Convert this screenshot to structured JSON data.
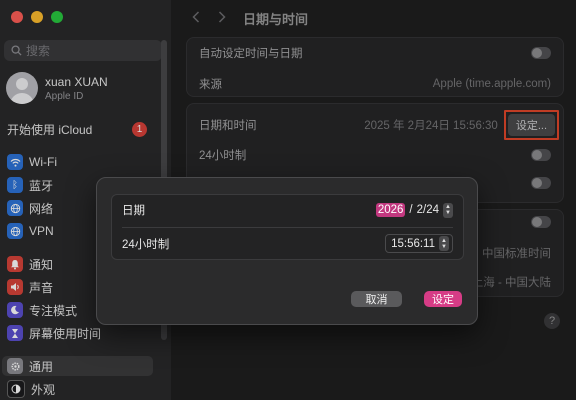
{
  "search": {
    "placeholder": "搜索"
  },
  "account": {
    "name": "xuan XUAN",
    "subtitle": "Apple ID"
  },
  "icloud": {
    "label": "开始使用 iCloud",
    "badge": "1"
  },
  "sidebar": {
    "items": [
      {
        "label": "Wi-Fi",
        "icon": "wifi-icon",
        "color": "#2d74d9"
      },
      {
        "label": "蓝牙",
        "icon": "bluetooth-icon",
        "color": "#2d74d9"
      },
      {
        "label": "网络",
        "icon": "globe-icon",
        "color": "#2d74d9"
      },
      {
        "label": "VPN",
        "icon": "vpn-globe-icon",
        "color": "#2d74d9"
      },
      {
        "label": "通知",
        "icon": "bell-icon",
        "color": "#d8443a"
      },
      {
        "label": "声音",
        "icon": "speaker-icon",
        "color": "#d8443a"
      },
      {
        "label": "专注模式",
        "icon": "moon-icon",
        "color": "#5b4fcf"
      },
      {
        "label": "屏幕使用时间",
        "icon": "hourglass-icon",
        "color": "#5b4fcf"
      },
      {
        "label": "通用",
        "icon": "gear-icon",
        "color": "#8e8e93"
      },
      {
        "label": "外观",
        "icon": "appearance-icon",
        "color": "#1c1c1e"
      }
    ]
  },
  "page": {
    "title": "日期与时间"
  },
  "settings": {
    "auto_time": {
      "label": "自动设定时间与日期"
    },
    "source": {
      "label": "来源",
      "value": "Apple (time.apple.com)"
    },
    "date_time": {
      "label": "日期和时间",
      "value": "2025 年 2月24日 15:56:30",
      "button": "设定..."
    },
    "h24": {
      "label": "24小时制"
    },
    "timezone_value": "中国标准时间",
    "location_value": "上海 - 中国大陆",
    "help": "?"
  },
  "dialog": {
    "date_label": "日期",
    "year": "2026",
    "month_day": "2/24",
    "h24_label": "24小时制",
    "time": "15:56:11",
    "cancel": "取消",
    "confirm": "设定"
  },
  "colors": {
    "accent": "#d63c86",
    "highlight_border": "#e2472b"
  }
}
